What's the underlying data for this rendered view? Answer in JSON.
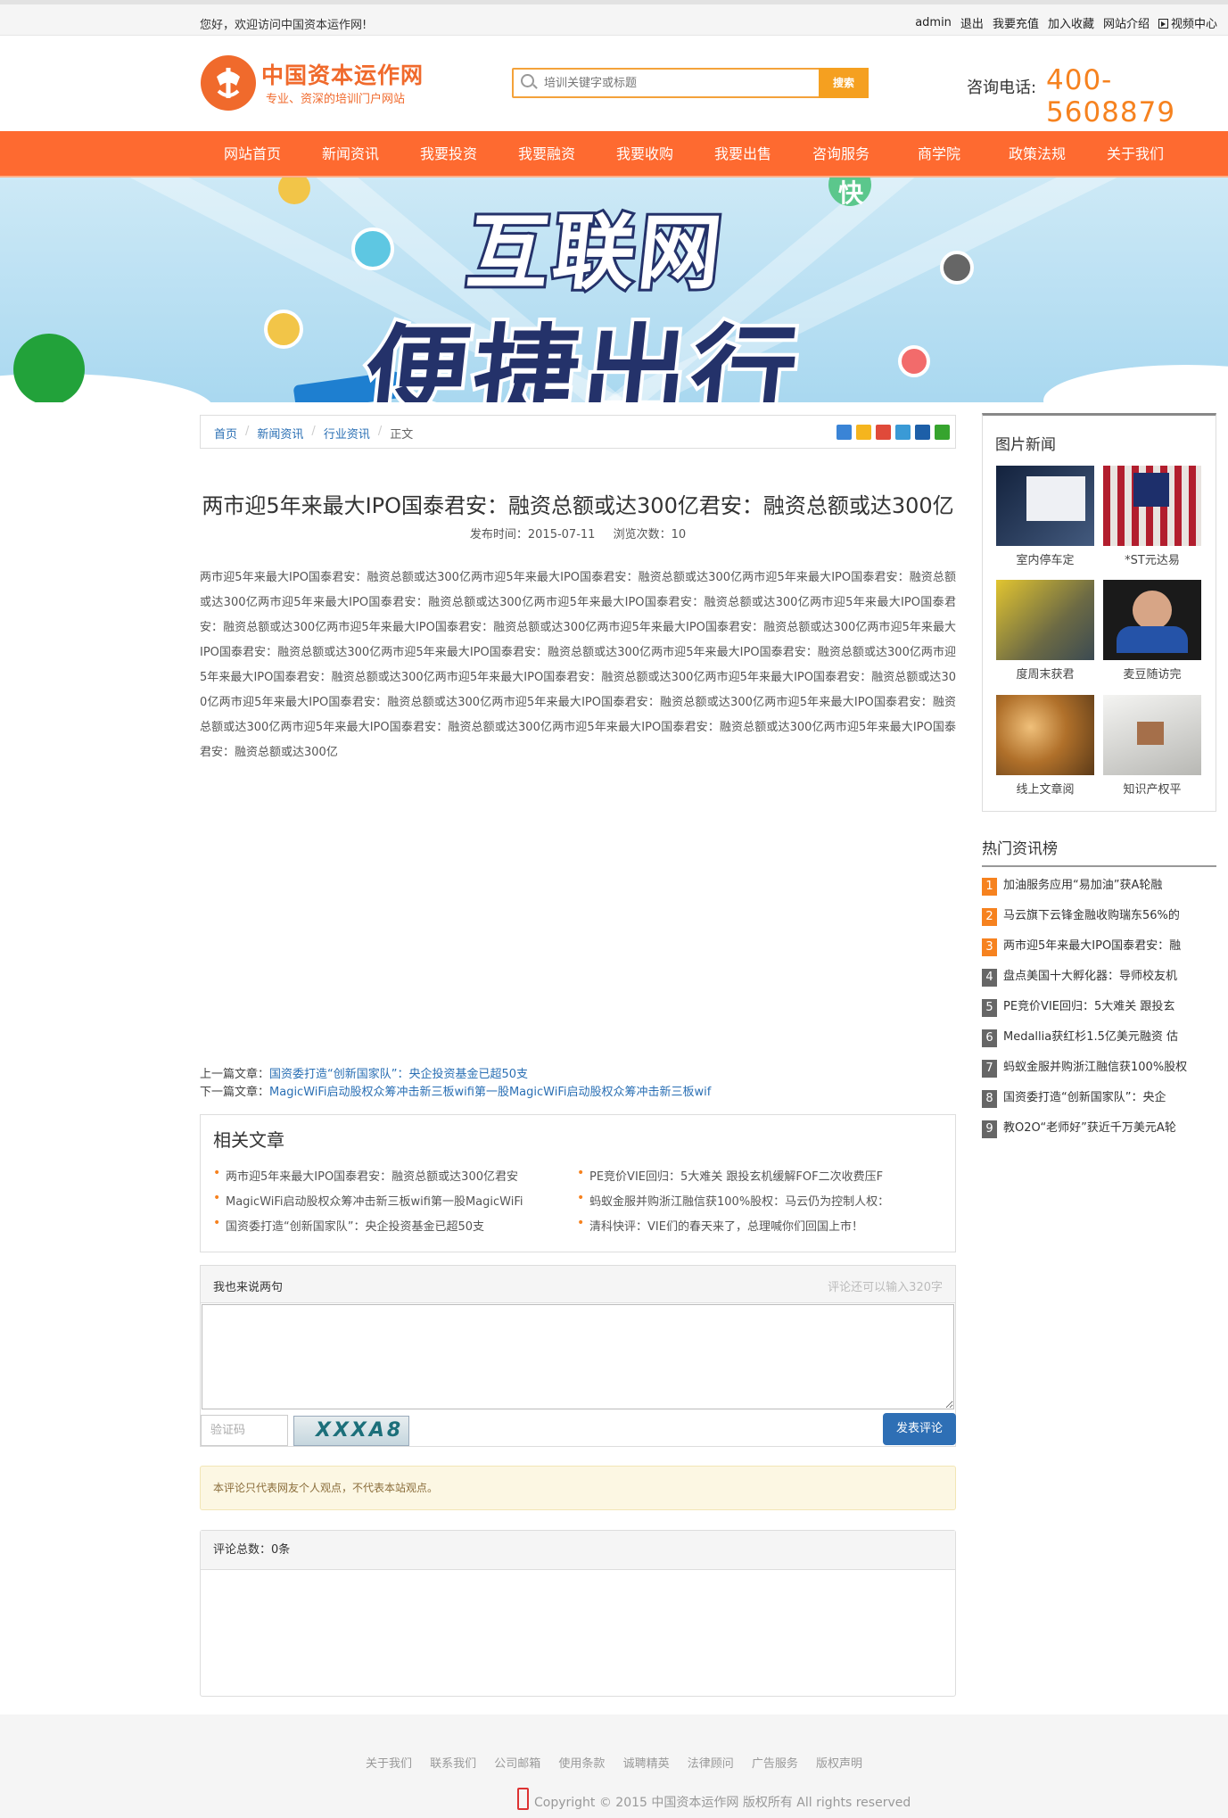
{
  "topbar": {
    "welcome": "您好，欢迎访问中国资本运作网!",
    "links": [
      "admin",
      "退出",
      "我要充值",
      "加入收藏",
      "网站介绍"
    ],
    "video": "视频中心"
  },
  "header": {
    "logo_title": "中国资本运作网",
    "logo_sub": "专业、资深的培训门户网站",
    "search_placeholder": "培训关键字或标题",
    "search_button": "搜索",
    "tel_label": "咨询电话:",
    "tel": "400-5608879",
    "accent": "#fe6a30"
  },
  "nav": [
    "网站首页",
    "新闻资讯",
    "我要投资",
    "我要融资",
    "我要收购",
    "我要出售",
    "咨询服务",
    "商学院",
    "政策法规",
    "关于我们"
  ],
  "banner": {
    "line1": "互联网",
    "line2": "便捷出行",
    "badge": "快"
  },
  "breadcrumb": [
    "首页",
    "新闻资讯",
    "行业资讯",
    "正文"
  ],
  "article": {
    "title": "两市迎5年来最大IPO国泰君安：融资总额或达300亿君安：融资总额或达300亿",
    "meta_date": "发布时间：2015-07-11",
    "meta_views": "浏览次数：10",
    "body": "两市迎5年来最大IPO国泰君安：融资总额或达300亿两市迎5年来最大IPO国泰君安：融资总额或达300亿两市迎5年来最大IPO国泰君安：融资总额或达300亿两市迎5年来最大IPO国泰君安：融资总额或达300亿两市迎5年来最大IPO国泰君安：融资总额或达300亿两市迎5年来最大IPO国泰君安：融资总额或达300亿两市迎5年来最大IPO国泰君安：融资总额或达300亿两市迎5年来最大IPO国泰君安：融资总额或达300亿两市迎5年来最大IPO国泰君安：融资总额或达300亿两市迎5年来最大IPO国泰君安：融资总额或达300亿两市迎5年来最大IPO国泰君安：融资总额或达300亿两市迎5年来最大IPO国泰君安：融资总额或达300亿两市迎5年来最大IPO国泰君安：融资总额或达300亿两市迎5年来最大IPO国泰君安：融资总额或达300亿两市迎5年来最大IPO国泰君安：融资总额或达300亿两市迎5年来最大IPO国泰君安：融资总额或达300亿两市迎5年来最大IPO国泰君安：融资总额或达300亿两市迎5年来最大IPO国泰君安：融资总额或达300亿两市迎5年来最大IPO国泰君安：融资总额或达300亿两市迎5年来最大IPO国泰君安：融资总额或达300亿",
    "prev_label": "上一篇文章：",
    "prev": "国资委打造“创新国家队”：央企投资基金已超50支",
    "next_label": "下一篇文章：",
    "next": "MagicWiFi启动股权众筹冲击新三板wifi第一股MagicWiFi启动股权众筹冲击新三板wif"
  },
  "related": {
    "title": "相关文章",
    "items": [
      "两市迎5年来最大IPO国泰君安：融资总额或达300亿君安",
      "PE竞价VIE回归：5大难关 跟投玄机缓解FOF二次收费压F",
      "MagicWiFi启动股权众筹冲击新三板wifi第一股MagicWiFi",
      "蚂蚁金服并购浙江融信获100%股权：马云仍为控制人权：",
      "国资委打造“创新国家队”：央企投资基金已超50支",
      "清科快评：VIE们的春天来了，总理喊你们回国上市！"
    ]
  },
  "comment": {
    "title": "我也来说两句",
    "limit": "评论还可以输入320字",
    "captcha_placeholder": "验证码",
    "captcha_text": "XXXA8",
    "submit": "发表评论",
    "notice": "本评论只代表网友个人观点，不代表本站观点。",
    "count": "评论总数：0条"
  },
  "sidebar": {
    "pic_title": "图片新闻",
    "pics": [
      "室内停车定",
      "*ST元达易",
      "度周末获君",
      "麦豆随访完",
      "线上文章阅",
      "知识产权平"
    ],
    "hot_title": "热门资讯榜",
    "hot": [
      {
        "n": "1",
        "t": "加油服务应用“易加油”获A轮融"
      },
      {
        "n": "2",
        "t": "马云旗下云锋金融收购瑞东56%的"
      },
      {
        "n": "3",
        "t": "两市迎5年来最大IPO国泰君安：融"
      },
      {
        "n": "4",
        "t": "盘点美国十大孵化器：导师校友机"
      },
      {
        "n": "5",
        "t": "PE竞价VIE回归：5大难关 跟投玄"
      },
      {
        "n": "6",
        "t": "Medallia获红杉1.5亿美元融资 估"
      },
      {
        "n": "7",
        "t": "蚂蚁金服并购浙江融信获100%股权"
      },
      {
        "n": "8",
        "t": "国资委打造“创新国家队”：央企"
      },
      {
        "n": "9",
        "t": "教O2O“老师好”获近千万美元A轮"
      }
    ]
  },
  "footer": {
    "links": [
      "关于我们",
      "联系我们",
      "公司邮箱",
      "使用条款",
      "诚聘精英",
      "法律顾问",
      "广告服务",
      "版权声明"
    ],
    "copyright": "Copyright © 2015 中国资本运作网 版权所有 All rights reserved"
  }
}
